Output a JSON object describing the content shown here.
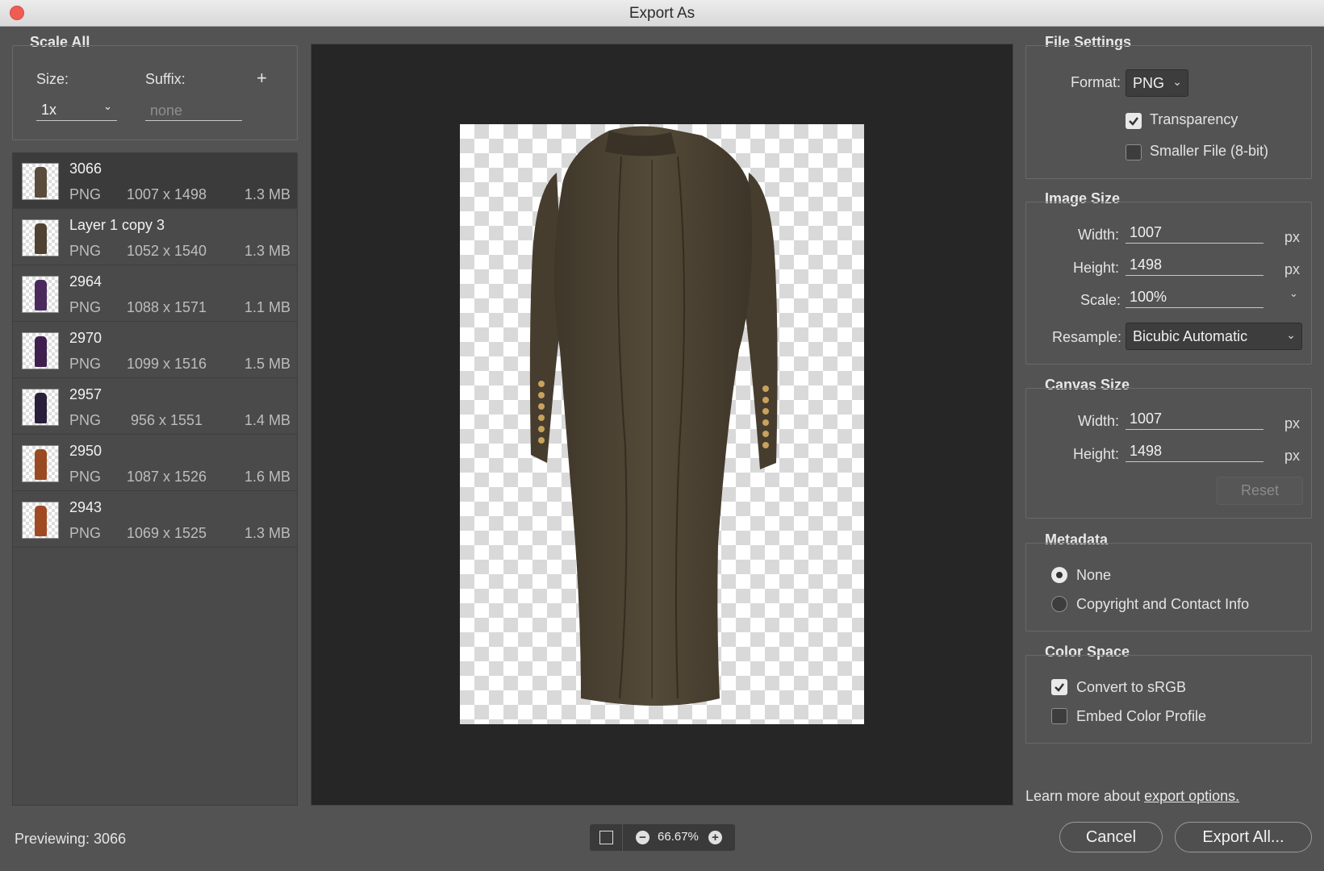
{
  "window": {
    "title": "Export As"
  },
  "scale_all": {
    "header": "Scale All",
    "size_label": "Size:",
    "suffix_label": "Suffix:",
    "add_label": "+",
    "size_value": "1x",
    "suffix_placeholder": "none"
  },
  "layers": [
    {
      "name": "3066",
      "format": "PNG",
      "dimensions": "1007 x 1498",
      "filesize": "1.3 MB",
      "color": "#5a4c3a"
    },
    {
      "name": "Layer 1 copy 3",
      "format": "PNG",
      "dimensions": "1052 x 1540",
      "filesize": "1.3 MB",
      "color": "#4f4232"
    },
    {
      "name": "2964",
      "format": "PNG",
      "dimensions": "1088 x 1571",
      "filesize": "1.1 MB",
      "color": "#4a2a5c"
    },
    {
      "name": "2970",
      "format": "PNG",
      "dimensions": "1099 x 1516",
      "filesize": "1.5 MB",
      "color": "#3e1f4e"
    },
    {
      "name": "2957",
      "format": "PNG",
      "dimensions": "956 x 1551",
      "filesize": "1.4 MB",
      "color": "#2a1f3a"
    },
    {
      "name": "2950",
      "format": "PNG",
      "dimensions": "1087 x 1526",
      "filesize": "1.6 MB",
      "color": "#9a4a22"
    },
    {
      "name": "2943",
      "format": "PNG",
      "dimensions": "1069 x 1525",
      "filesize": "1.3 MB",
      "color": "#a04a24"
    }
  ],
  "file_settings": {
    "header": "File Settings",
    "format_label": "Format:",
    "format_value": "PNG",
    "transparency_label": "Transparency",
    "transparency_checked": true,
    "smaller_file_label": "Smaller File (8-bit)",
    "smaller_file_checked": false
  },
  "image_size": {
    "header": "Image Size",
    "width_label": "Width:",
    "width_value": "1007",
    "height_label": "Height:",
    "height_value": "1498",
    "scale_label": "Scale:",
    "scale_value": "100%",
    "resample_label": "Resample:",
    "resample_value": "Bicubic Automatic",
    "unit": "px"
  },
  "canvas_size": {
    "header": "Canvas Size",
    "width_label": "Width:",
    "width_value": "1007",
    "height_label": "Height:",
    "height_value": "1498",
    "unit": "px",
    "reset_label": "Reset"
  },
  "metadata": {
    "header": "Metadata",
    "none_label": "None",
    "copyright_label": "Copyright and Contact Info",
    "selected": "None"
  },
  "color_space": {
    "header": "Color Space",
    "srgb_label": "Convert to sRGB",
    "srgb_checked": true,
    "embed_label": "Embed Color Profile",
    "embed_checked": false
  },
  "footer": {
    "learn_more_text": "Learn more about",
    "learn_more_link": "export options.",
    "previewing_label": "Previewing: 3066",
    "zoom_value": "66.67%",
    "cancel_label": "Cancel",
    "export_label": "Export All..."
  },
  "colors": {
    "coat": "#4e4434",
    "buttons": "#c9a25c",
    "accent_close": "#ee5c54"
  }
}
